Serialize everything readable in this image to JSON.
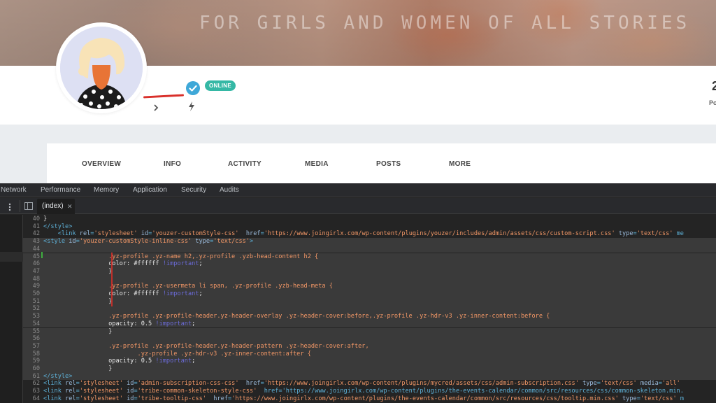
{
  "cover": {
    "tagline": "FOR GIRLS AND WOMEN OF ALL STORIES"
  },
  "profile": {
    "status_badge": "ONLINE",
    "stat_value": "2",
    "stat_label": "Po"
  },
  "nav": {
    "items": [
      "OVERVIEW",
      "INFO",
      "ACTIVITY",
      "MEDIA",
      "POSTS",
      "MORE"
    ]
  },
  "devtools": {
    "tabs": [
      "Network",
      "Performance",
      "Memory",
      "Application",
      "Security",
      "Audits"
    ],
    "open_file": "(index)",
    "lines": [
      {
        "n": "40",
        "text": "}"
      },
      {
        "n": "41",
        "text": "</style>"
      },
      {
        "n": "42",
        "text": "    <link rel='stylesheet' id='youzer-customStyle-css'  href='https://www.joingirlx.com/wp-content/plugins/youzer/includes/admin/assets/css/custom-script.css' type='text/css' me"
      },
      {
        "n": "43",
        "text": "<style id='youzer-customStyle-inline-css' type='text/css'>"
      },
      {
        "n": "44",
        "text": ""
      },
      {
        "n": "45",
        "text": "                  .yz-profile .yz-name h2,.yz-profile .yzb-head-content h2 {"
      },
      {
        "n": "46",
        "text": "                  color: #ffffff !important;"
      },
      {
        "n": "47",
        "text": "                  }"
      },
      {
        "n": "48",
        "text": ""
      },
      {
        "n": "49",
        "text": "                  .yz-profile .yz-usermeta li span, .yz-profile .yzb-head-meta {"
      },
      {
        "n": "50",
        "text": "                  color: #ffffff !important;"
      },
      {
        "n": "51",
        "text": "                  }"
      },
      {
        "n": "52",
        "text": ""
      },
      {
        "n": "53",
        "text": "                  .yz-profile .yz-profile-header.yz-header-overlay .yz-header-cover:before,.yz-profile .yz-hdr-v3 .yz-inner-content:before {"
      },
      {
        "n": "54",
        "text": "                  opacity: 0.5 !important;"
      },
      {
        "n": "55",
        "text": "                  }"
      },
      {
        "n": "56",
        "text": ""
      },
      {
        "n": "57",
        "text": "                  .yz-profile .yz-profile-header.yz-header-pattern .yz-header-cover:after,"
      },
      {
        "n": "58",
        "text": "                          .yz-profile .yz-hdr-v3 .yz-inner-content:after {"
      },
      {
        "n": "59",
        "text": "                  opacity: 0.5 !important;"
      },
      {
        "n": "60",
        "text": "                  }"
      },
      {
        "n": "61",
        "text": "</style>"
      },
      {
        "n": "62",
        "text": "<link rel='stylesheet' id='admin-subscription-css-css'  href='https://www.joingirlx.com/wp-content/plugins/mycred/assets/css/admin-subscription.css' type='text/css' media='all' "
      },
      {
        "n": "63",
        "text": "<link rel='stylesheet' id='tribe-common-skeleton-style-css'  href='https://www.joingirlx.com/wp-content/plugins/the-events-calendar/common/src/resources/css/common-skeleton.min."
      },
      {
        "n": "64",
        "text": "<link rel='stylesheet' id='tribe-tooltip-css'  href='https://www.joingirlx.com/wp-content/plugins/the-events-calendar/common/src/resources/css/tooltip.min.css' type='text/css' m"
      }
    ]
  },
  "colors": {
    "accent_online": "#35b8a5",
    "verified": "#3fa8d8",
    "devtools_bg": "#242424",
    "string": "#f29766",
    "important": "#6b6bd8"
  },
  "icons": [
    "verified-icon",
    "chevron-right-icon",
    "bolt-icon",
    "menu-dots-icon",
    "panel-toggle-icon",
    "close-icon"
  ]
}
